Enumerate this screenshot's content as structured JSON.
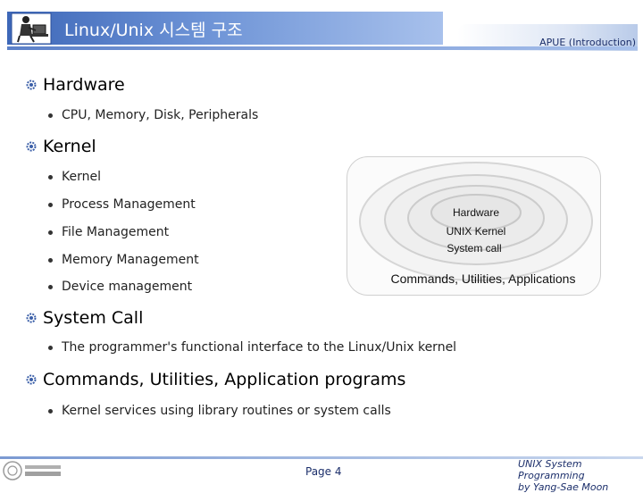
{
  "header": {
    "title": "Linux/Unix 시스템 구조",
    "subtitle": "APUE (Introduction)",
    "icon": "person-at-computer-icon"
  },
  "sections": [
    {
      "heading": "Hardware",
      "bullets": [
        "CPU, Memory, Disk, Peripherals"
      ]
    },
    {
      "heading": "Kernel",
      "bullets": [
        "Kernel",
        "Process Management",
        "File Management",
        "Memory Management",
        "Device management"
      ]
    },
    {
      "heading": "System Call",
      "bullets": [
        "The programmer's functional interface to the Linux/Unix kernel"
      ]
    },
    {
      "heading": "Commands, Utilities, Application programs",
      "bullets": [
        "Kernel services using library routines or system calls"
      ]
    }
  ],
  "diagram": {
    "layers": [
      "Hardware",
      "UNIX Kernel",
      "System call",
      "Commands, Utilities, Applications"
    ]
  },
  "footer": {
    "page": "Page 4",
    "course_line1": "UNIX System Programming",
    "course_line2": "by Yang-Sae Moon"
  },
  "colors": {
    "header_blue": "#3d67b8",
    "accent_navy": "#1c2f6b"
  }
}
